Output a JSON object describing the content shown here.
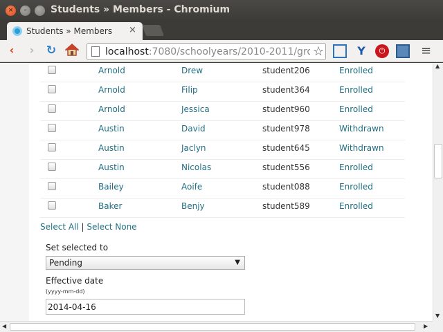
{
  "window": {
    "title": "Students » Members - Chromium",
    "close_glyph": "×",
    "min_glyph": "–",
    "max_glyph": ""
  },
  "tab": {
    "title": "Students » Members",
    "close_glyph": "×"
  },
  "toolbar": {
    "back_glyph": "‹",
    "forward_glyph": "›",
    "reload_glyph": "↻",
    "home_glyph": "⌂",
    "url_host": "localhost",
    "url_rest": ":7080/schoolyears/2010-2011/grou",
    "star_glyph": "☆",
    "ext_y_glyph": "Y",
    "ext_stop_glyph": "⏻",
    "menu_glyph": "≡"
  },
  "members": {
    "rows": [
      {
        "last": "Arnold",
        "first": "Drew",
        "username": "student206",
        "status": "Enrolled"
      },
      {
        "last": "Arnold",
        "first": "Filip",
        "username": "student364",
        "status": "Enrolled"
      },
      {
        "last": "Arnold",
        "first": "Jessica",
        "username": "student960",
        "status": "Enrolled"
      },
      {
        "last": "Austin",
        "first": "David",
        "username": "student978",
        "status": "Withdrawn"
      },
      {
        "last": "Austin",
        "first": "Jaclyn",
        "username": "student645",
        "status": "Withdrawn"
      },
      {
        "last": "Austin",
        "first": "Nicolas",
        "username": "student556",
        "status": "Enrolled"
      },
      {
        "last": "Bailey",
        "first": "Aoife",
        "username": "student088",
        "status": "Enrolled"
      },
      {
        "last": "Baker",
        "first": "Benjy",
        "username": "student589",
        "status": "Enrolled"
      }
    ],
    "select_all": "Select All",
    "separator": "|",
    "select_none": "Select None"
  },
  "form": {
    "set_selected_label": "Set selected to",
    "set_selected_value": "Pending",
    "effective_date_label": "Effective date",
    "date_format_hint": "(yyyy-mm-dd)",
    "effective_date_value": "2014-04-16"
  },
  "scrollbars": {
    "up": "▲",
    "down": "▼",
    "left": "◀",
    "right": "▶",
    "vertical_position": 0.35
  },
  "colors": {
    "link": "#216f83",
    "titlebar": "#3c3b37",
    "close_button": "#df4b16"
  }
}
